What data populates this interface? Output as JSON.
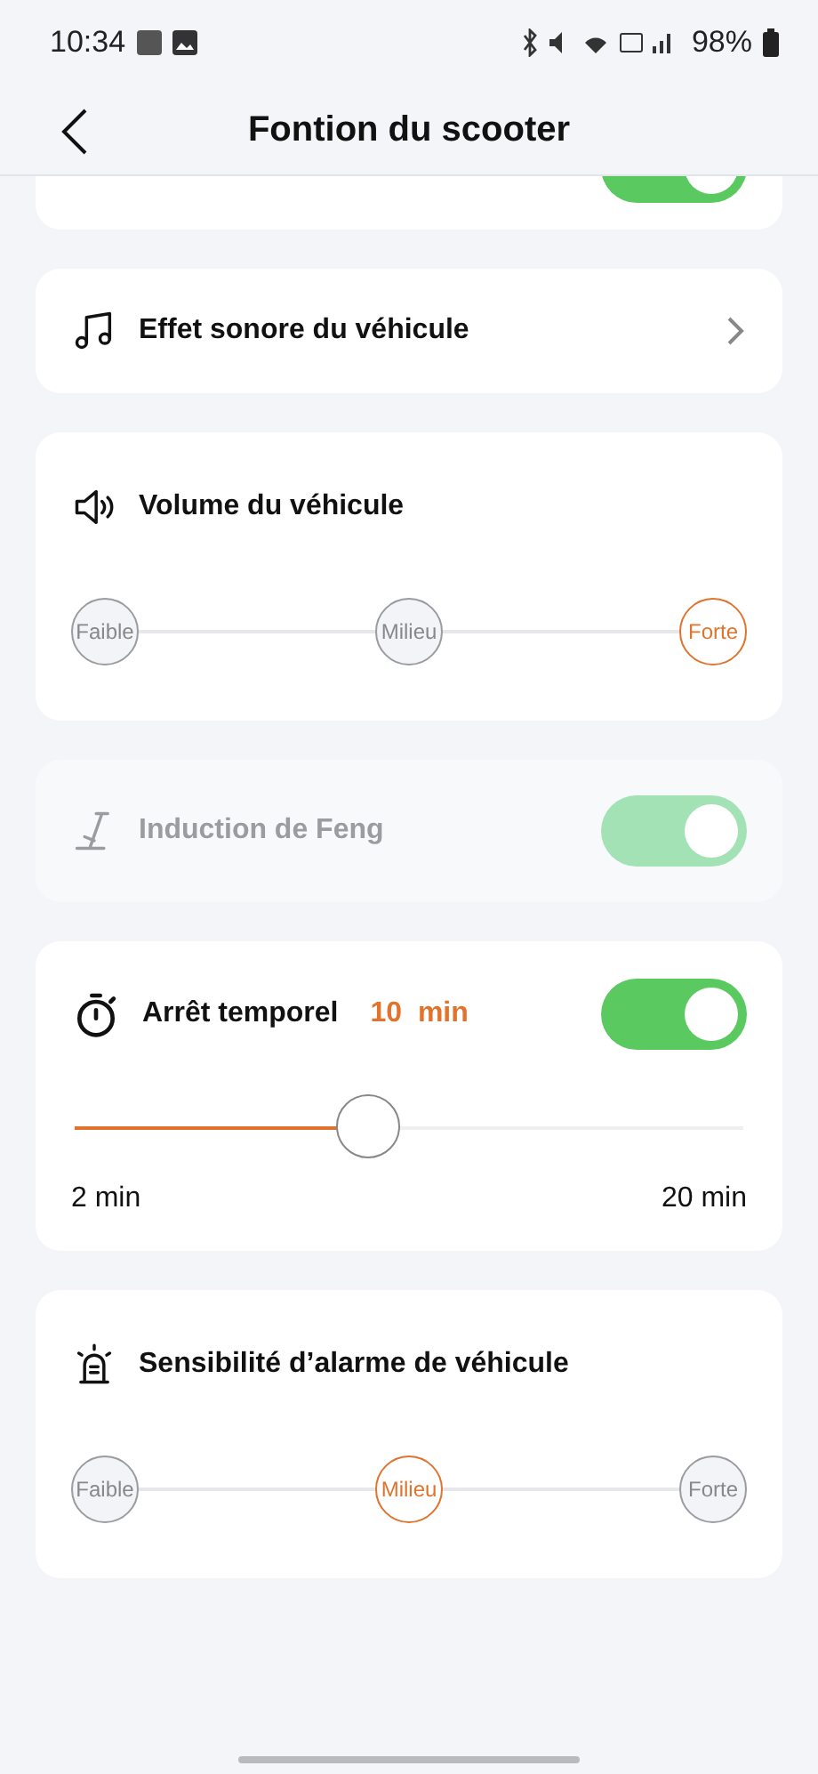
{
  "status_bar": {
    "time": "10:34",
    "battery": "98%"
  },
  "header": {
    "title": "Fontion du scooter"
  },
  "cards": [
    {
      "kind": "partial",
      "on": true
    },
    {
      "kind": "link",
      "label": "Effet sonore du véhicule"
    },
    {
      "kind": "levels",
      "label": "Volume du véhicule",
      "options": [
        {
          "label": "Faible",
          "selected": false
        },
        {
          "label": "Milieu",
          "selected": false
        },
        {
          "label": "Forte",
          "selected": true
        }
      ]
    },
    {
      "kind": "toggle",
      "label": "Induction de Feng",
      "on": true,
      "disabled": true
    },
    {
      "kind": "timer",
      "label": "Arrêt temporel",
      "value": "10  min",
      "on": true,
      "level": 0.44,
      "min_label": "2 min",
      "max_label": "20 min"
    },
    {
      "kind": "levels",
      "label": "Sensibilité d’alarme de véhicule",
      "options": [
        {
          "label": "Faible",
          "selected": false
        },
        {
          "label": "Milieu",
          "selected": true
        },
        {
          "label": "Forte",
          "selected": false
        }
      ]
    }
  ]
}
